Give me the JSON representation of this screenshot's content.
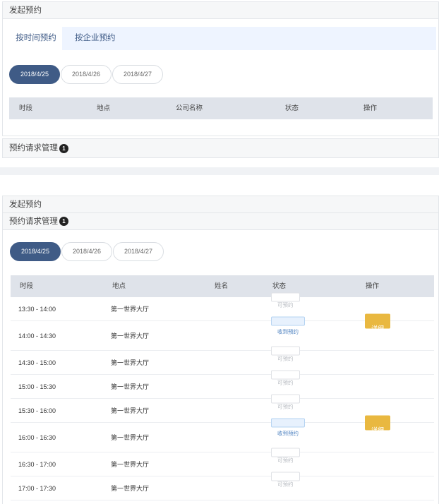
{
  "top": {
    "header": "发起预约",
    "tabs": [
      "按时间预约",
      "按企业预约"
    ],
    "dates": [
      "2018/4/25",
      "2018/4/26",
      "2018/4/27"
    ],
    "columns": [
      "时段",
      "地点",
      "公司名称",
      "状态",
      "操作"
    ],
    "footer": {
      "label": "预约请求管理",
      "badge": "1"
    }
  },
  "bottom": {
    "header1": "发起预约",
    "header2": {
      "label": "预约请求管理",
      "badge": "1"
    },
    "dates": [
      "2018/4/25",
      "2018/4/26",
      "2018/4/27"
    ],
    "columns": [
      "时段",
      "地点",
      "姓名",
      "状态",
      "操作"
    ],
    "rows": [
      {
        "time": "13:30 - 14:00",
        "place": "第一世界大厅",
        "status": "可预约",
        "status_type": "free",
        "action": ""
      },
      {
        "time": "14:00 - 14:30",
        "place": "第一世界大厅",
        "status": "收到预约",
        "status_type": "recv",
        "action": "详细"
      },
      {
        "time": "14:30 - 15:00",
        "place": "第一世界大厅",
        "status": "可预约",
        "status_type": "free",
        "action": ""
      },
      {
        "time": "15:00 - 15:30",
        "place": "第一世界大厅",
        "status": "可预约",
        "status_type": "free",
        "action": ""
      },
      {
        "time": "15:30 - 16:00",
        "place": "第一世界大厅",
        "status": "可预约",
        "status_type": "free",
        "action": ""
      },
      {
        "time": "16:00 - 16:30",
        "place": "第一世界大厅",
        "status": "收到预约",
        "status_type": "recv",
        "action": "详细"
      },
      {
        "time": "16:30 - 17:00",
        "place": "第一世界大厅",
        "status": "可预约",
        "status_type": "free",
        "action": ""
      },
      {
        "time": "17:00 - 17:30",
        "place": "第一世界大厅",
        "status": "可预约",
        "status_type": "free",
        "action": ""
      }
    ]
  },
  "colors": {
    "primary": "#3f5b86",
    "detail": "#e9b840",
    "header_bg": "#dfe3ea"
  }
}
